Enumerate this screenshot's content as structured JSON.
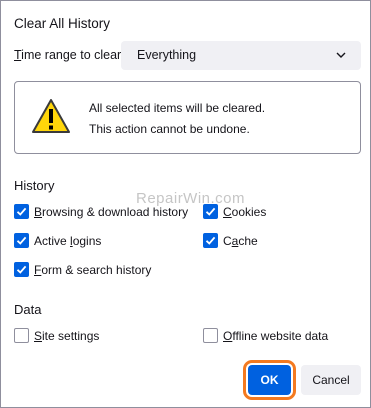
{
  "dialog": {
    "title": "Clear All History",
    "time_range": {
      "label_pre": "",
      "label_underlined": "T",
      "label_post": "ime range to clear:",
      "selected": "Everything"
    },
    "warning": {
      "line1": "All selected items will be cleared.",
      "line2": "This action cannot be undone."
    },
    "history": {
      "heading": "History",
      "items": [
        {
          "pre": "",
          "u": "B",
          "post": "rowsing & download history",
          "checked": true
        },
        {
          "pre": "",
          "u": "C",
          "post": "ookies",
          "checked": true
        },
        {
          "pre": "Active ",
          "u": "l",
          "post": "ogins",
          "checked": true
        },
        {
          "pre": "C",
          "u": "a",
          "post": "che",
          "checked": true
        },
        {
          "pre": "",
          "u": "F",
          "post": "orm & search history",
          "checked": true
        }
      ]
    },
    "data": {
      "heading": "Data",
      "items": [
        {
          "pre": "",
          "u": "S",
          "post": "ite settings",
          "checked": false
        },
        {
          "pre": "",
          "u": "O",
          "post": "ffline website data",
          "checked": false
        }
      ]
    },
    "buttons": {
      "ok": "OK",
      "cancel": "Cancel"
    },
    "watermark": "RepairWin.com"
  },
  "colors": {
    "accent": "#0061e0",
    "highlight": "#f47a20",
    "warning_yellow": "#ffd60a"
  }
}
